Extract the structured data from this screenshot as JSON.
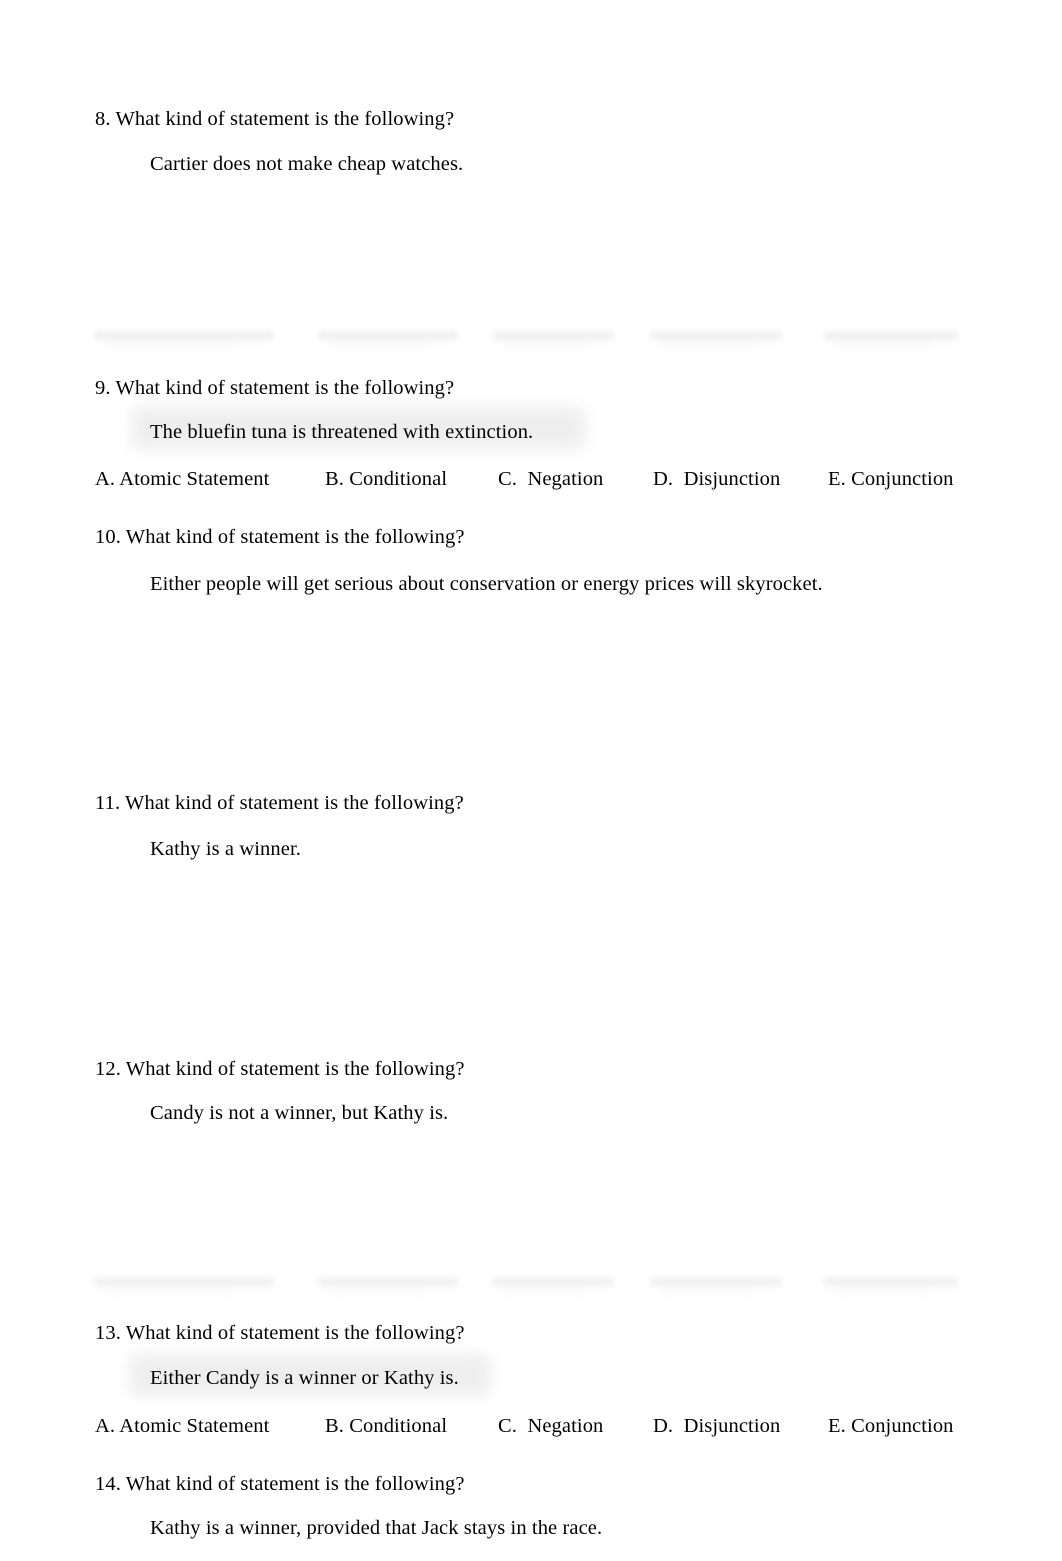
{
  "document": {
    "type": "quiz-worksheet",
    "page_background": "#ffffff",
    "text_color": "#000000",
    "highlight_color": "#efeeee",
    "ghost_color": "#e4e4e6"
  },
  "options": {
    "a": "A. Atomic Statement",
    "b": "B. Conditional",
    "c": "C.  Negation",
    "d": "D.  Disjunction",
    "e": "E. Conjunction"
  },
  "questions": [
    {
      "number": "8.",
      "prompt": "What kind of statement is the following?",
      "statement": "Cartier does not make cheap watches.",
      "highlighted": false,
      "options_visible": false
    },
    {
      "number": "9.",
      "prompt": "What kind of statement is the following?",
      "statement": "The bluefin tuna is threatened with extinction.",
      "highlighted": true,
      "options_visible": true
    },
    {
      "number": "10.",
      "prompt": "What kind of statement is the following?",
      "statement": "Either people will get serious about conservation or energy prices will skyrocket.",
      "highlighted": false,
      "options_visible": false
    },
    {
      "number": "11.",
      "prompt": "What kind of statement is the following?",
      "statement": "Kathy is a winner.",
      "highlighted": false,
      "options_visible": false
    },
    {
      "number": "12.",
      "prompt": "What kind of statement is the following?",
      "statement": "Candy is not a winner, but Kathy is.",
      "highlighted": false,
      "options_visible": false
    },
    {
      "number": "13.",
      "prompt": "What kind of statement is the following?",
      "statement": "Either Candy is a winner or Kathy is.",
      "highlighted": true,
      "options_visible": true
    },
    {
      "number": "14.",
      "prompt": "What kind of statement is the following?",
      "statement": "Kathy is a winner, provided that Jack stays in the race.",
      "highlighted": false,
      "options_visible": false
    }
  ]
}
